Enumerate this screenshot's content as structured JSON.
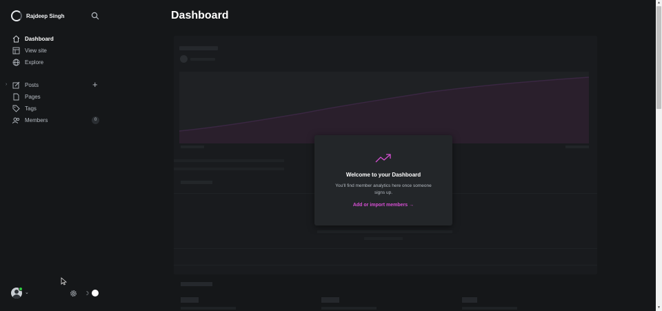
{
  "sidebar": {
    "brand_name": "Rajdeep Singh",
    "items": [
      {
        "label": "Dashboard",
        "icon": "home-icon",
        "active": true
      },
      {
        "label": "View site",
        "icon": "layout-icon"
      },
      {
        "label": "Explore",
        "icon": "globe-icon"
      },
      {
        "label": "Posts",
        "icon": "pencil-icon"
      },
      {
        "label": "Pages",
        "icon": "page-icon"
      },
      {
        "label": "Tags",
        "icon": "tag-icon"
      },
      {
        "label": "Members",
        "icon": "members-icon",
        "count": "0"
      }
    ]
  },
  "main": {
    "title": "Dashboard"
  },
  "welcome": {
    "title": "Welcome to your Dashboard",
    "text": "You'll find member analytics here once someone signs up.",
    "link": "Add or import members →"
  },
  "colors": {
    "background": "#151719",
    "accent": "#d64fd3",
    "online": "#30cf43"
  }
}
